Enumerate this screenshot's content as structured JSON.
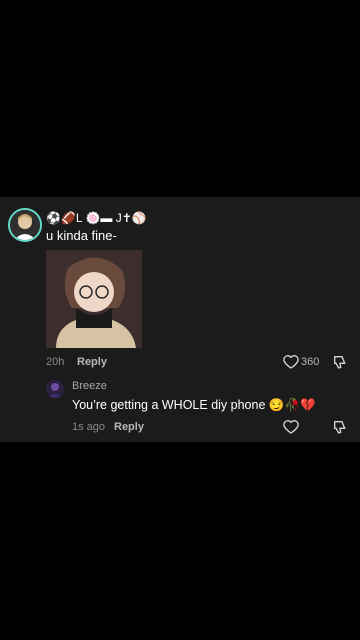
{
  "comment": {
    "username": "⚽🏈L 🍥▬ J✝⚾",
    "text": "u kinda fine-",
    "image": "cartoon-person-with-glasses",
    "time": "20h",
    "reply_label": "Reply",
    "likes": "360"
  },
  "reply": {
    "username": "Breeze",
    "text": "You’re getting a WHOLE diy phone 😏🥀💔",
    "time": "1s ago",
    "reply_label": "Reply"
  },
  "colors": {
    "background": "#000000",
    "panel": "#1b1b1b",
    "avatar_ring": "#63d9c9",
    "muted_text": "#8a8a8a"
  }
}
